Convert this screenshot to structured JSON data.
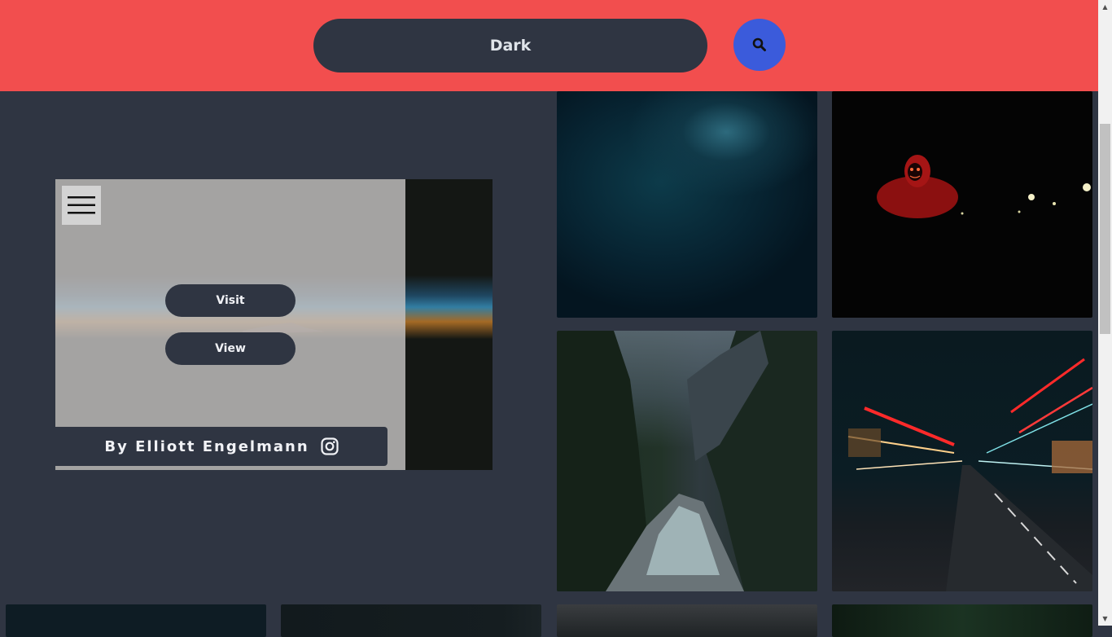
{
  "search": {
    "value": "Dark",
    "button_icon": "search-icon"
  },
  "featured": {
    "menu_icon": "hamburger-menu-icon",
    "visit_label": "Visit",
    "view_label": "View",
    "author": "By Elliott Engelmann",
    "author_icon": "instagram-icon"
  },
  "colors": {
    "header": "#f24e4e",
    "page_background": "#2f3542",
    "search_button": "#3b5bdb"
  }
}
